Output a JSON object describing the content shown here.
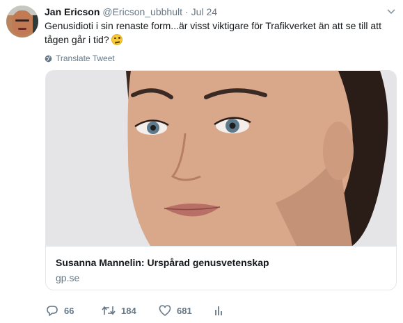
{
  "tweet": {
    "author_name": "Jan Ericson",
    "handle": "@Ericson_ubbhult",
    "separator": "·",
    "date": "Jul 24",
    "text": "Genusidioti i sin renaste form...är visst viktigare för Trafikverket än att se till att tågen går i tid?",
    "emoji": "rolling-eyes-emoji",
    "translate_label": "Translate Tweet"
  },
  "card": {
    "title": "Susanna Mannelin: Urspårad genusvetenskap",
    "domain": "gp.se"
  },
  "actions": {
    "replies": "66",
    "retweets": "184",
    "likes": "681"
  },
  "colors": {
    "primary_text": "#14171a",
    "secondary_text": "#657786",
    "border": "#e1e8ed"
  }
}
